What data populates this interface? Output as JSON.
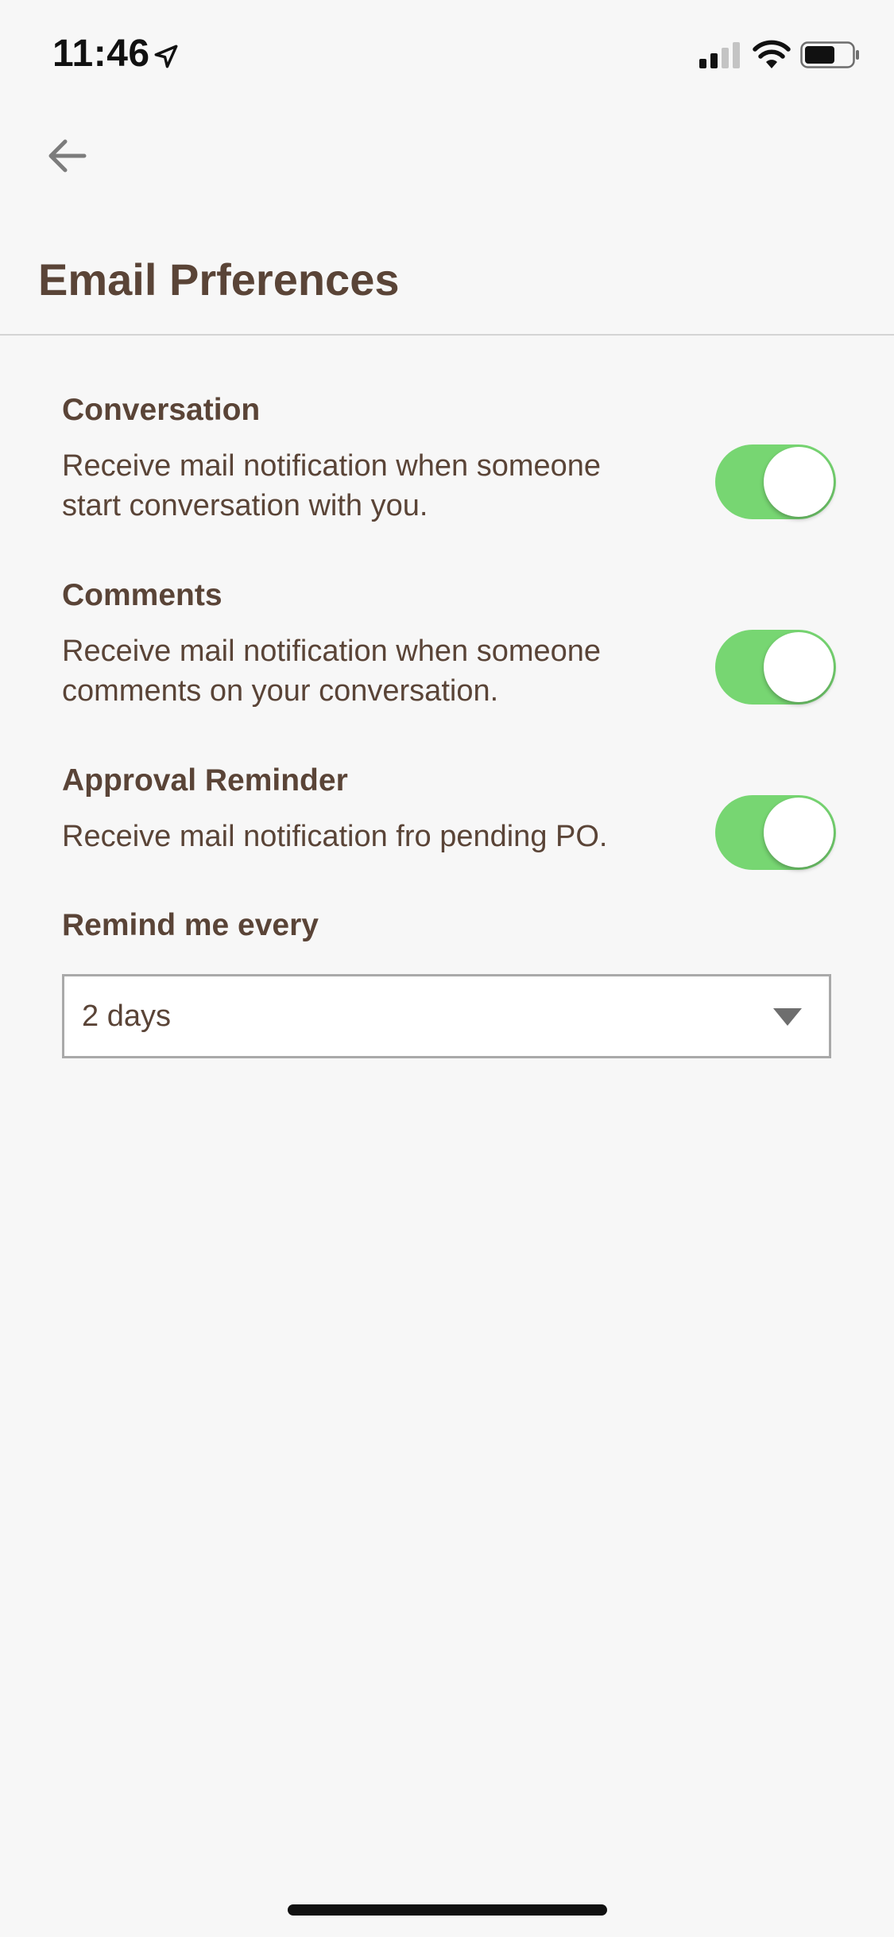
{
  "status_bar": {
    "time": "11:46",
    "icons": [
      "location-arrow-icon",
      "cellular-signal-icon",
      "wifi-icon",
      "battery-icon"
    ]
  },
  "header": {
    "back_icon": "arrow-left-icon",
    "title": "Email Prferences"
  },
  "preferences": [
    {
      "title": "Conversation",
      "description": "Receive mail notification when someone start conversation with you.",
      "enabled": true
    },
    {
      "title": "Comments",
      "description": "Receive mail notification when someone comments on your conversation.",
      "enabled": true
    },
    {
      "title": "Approval Reminder",
      "description": "Receive mail notification fro pending PO.",
      "enabled": true
    }
  ],
  "reminder": {
    "label": "Remind me every",
    "selected": "2 days",
    "caret_icon": "caret-down-icon"
  },
  "colors": {
    "background": "#f7f7f7",
    "text": "#5a4437",
    "toggle_on": "#77d672",
    "divider": "#d4d4d4"
  }
}
